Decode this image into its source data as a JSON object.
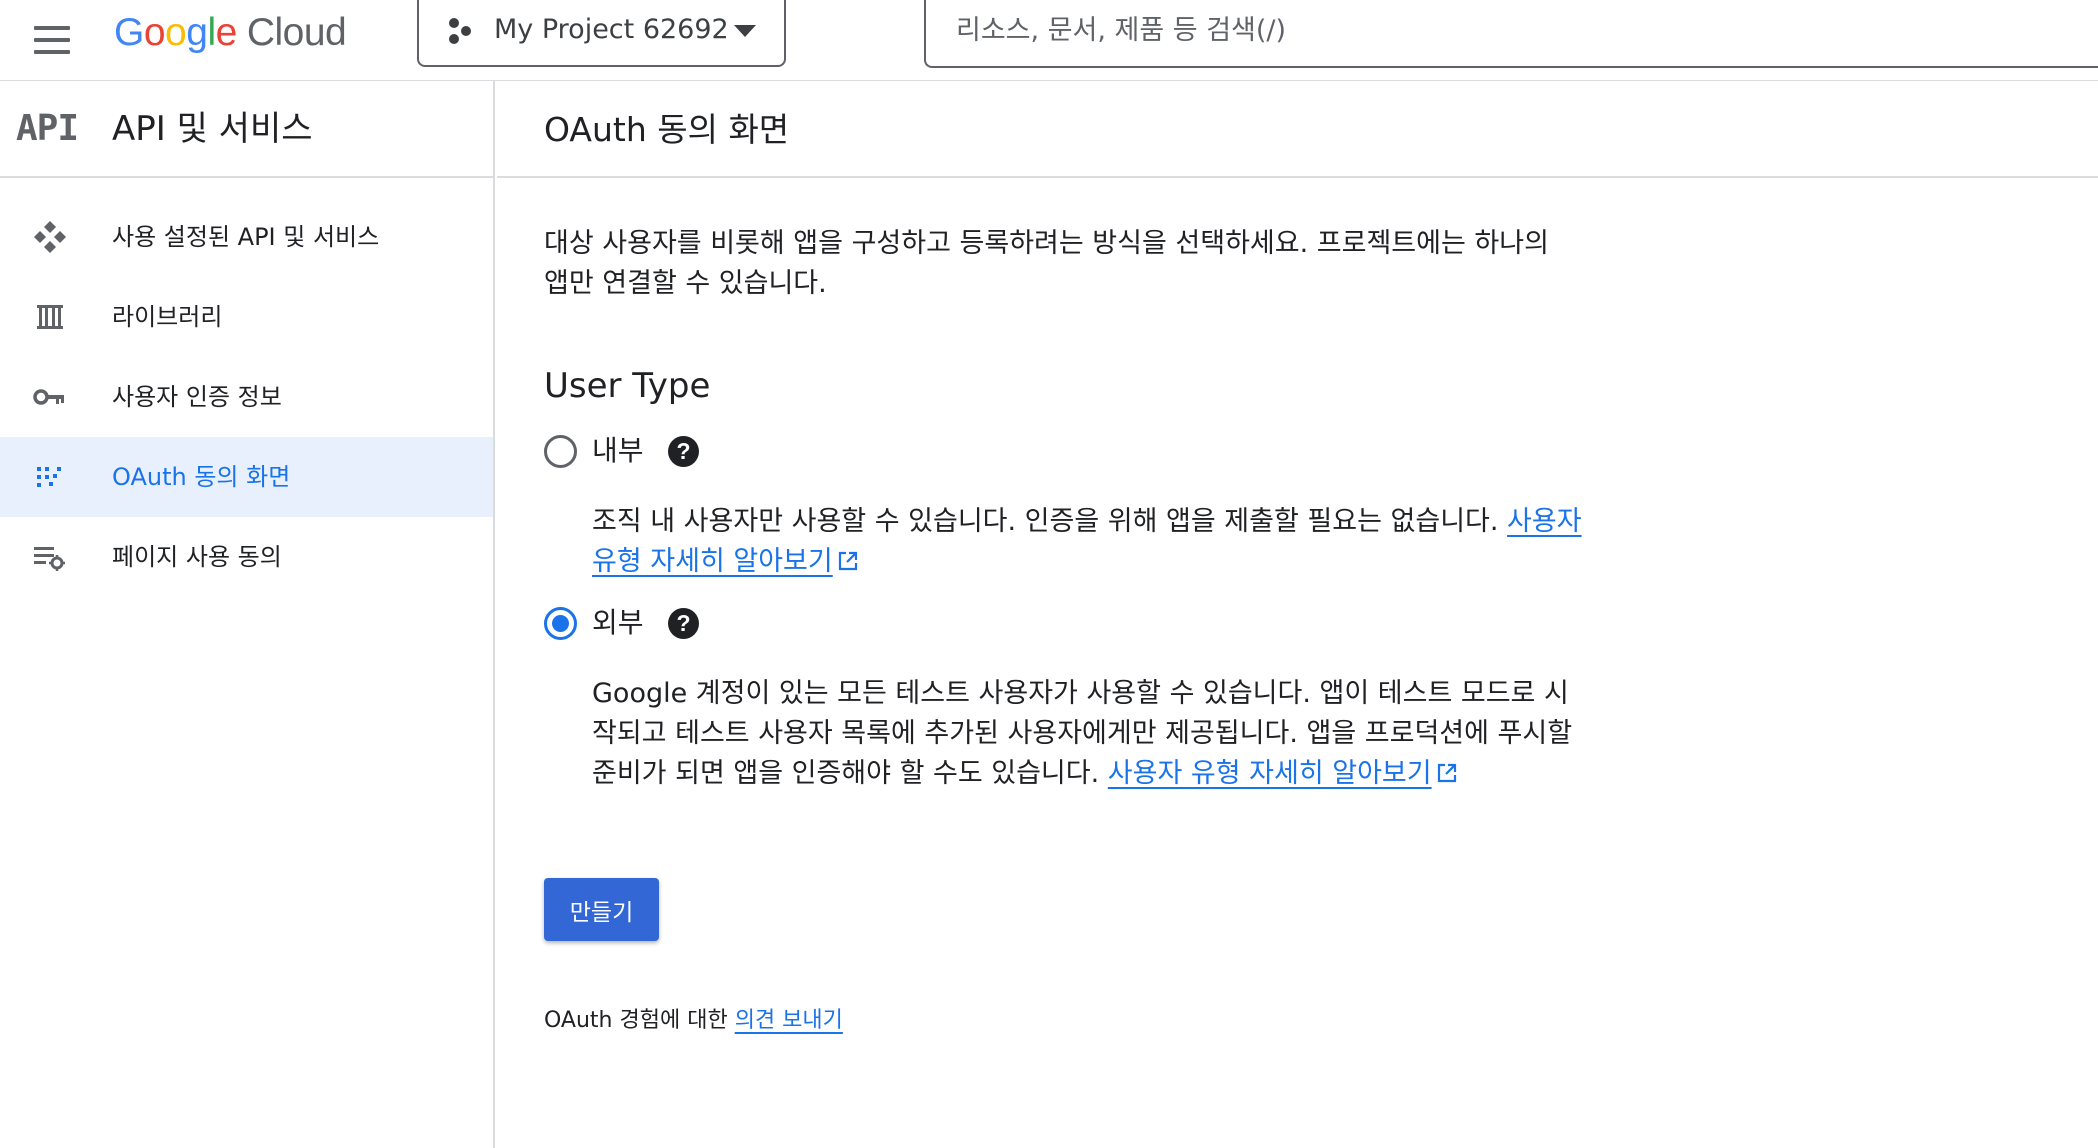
{
  "header": {
    "logo": {
      "letters": [
        "G",
        "o",
        "o",
        "g",
        "l",
        "e"
      ],
      "product": "Cloud"
    },
    "project_name": "My Project 62692",
    "search_placeholder": "리소스, 문서, 제품 등 검색(/)"
  },
  "sidebar": {
    "badge": "API",
    "title": "API 및 서비스",
    "items": [
      {
        "label": "사용 설정된 API 및 서비스",
        "icon": "api-diamond-icon",
        "active": false
      },
      {
        "label": "라이브러리",
        "icon": "library-icon",
        "active": false
      },
      {
        "label": "사용자 인증 정보",
        "icon": "key-icon",
        "active": false
      },
      {
        "label": "OAuth 동의 화면",
        "icon": "oauth-dots-icon",
        "active": true
      },
      {
        "label": "페이지 사용 동의",
        "icon": "settings-list-icon",
        "active": false
      }
    ]
  },
  "main": {
    "title": "OAuth 동의 화면",
    "intro": "대상 사용자를 비롯해 앱을 구성하고 등록하려는 방식을 선택하세요. 프로젝트에는 하나의 앱만 연결할 수 있습니다.",
    "user_type_title": "User Type",
    "options": [
      {
        "label": "내부",
        "checked": false,
        "description": "조직 내 사용자만 사용할 수 있습니다. 인증을 위해 앱을 제출할 필요는 없습니다. ",
        "link": "사용자 유형 자세히 알아보기"
      },
      {
        "label": "외부",
        "checked": true,
        "description": "Google 계정이 있는 모든 테스트 사용자가 사용할 수 있습니다. 앱이 테스트 모드로 시작되고 테스트 사용자 목록에 추가된 사용자에게만 제공됩니다. 앱을 프로덕션에 푸시할 준비가 되면 앱을 인증해야 할 수도 있습니다. ",
        "link": "사용자 유형 자세히 알아보기"
      }
    ],
    "help_glyph": "?",
    "create_button": "만들기",
    "feedback_prefix": "OAuth 경험에 대한 ",
    "feedback_link": "의견 보내기"
  },
  "colors": {
    "accent": "#1a73e8",
    "button": "#3367d6",
    "active_bg": "#e8f0fe",
    "divider": "#dadce0"
  }
}
